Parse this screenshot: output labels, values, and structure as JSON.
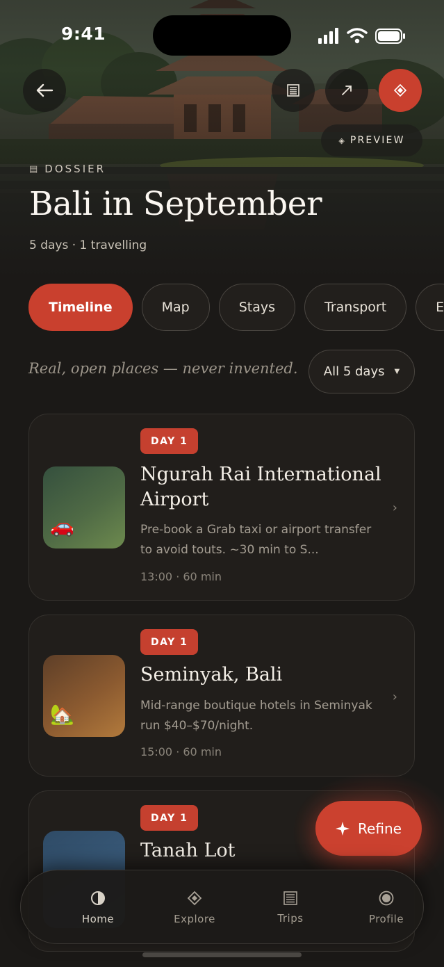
{
  "status_bar": {
    "time": "9:41"
  },
  "header": {
    "section_label": "DOSSIER",
    "title": "Bali in September",
    "meta": "5 days · 1 travelling",
    "preview_label": "PREVIEW",
    "icons": {
      "back": "arrow-left-icon",
      "document": "document-icon",
      "share": "arrow-up-right-icon",
      "diamond": "diamond-icon"
    }
  },
  "tabs": [
    {
      "label": "Timeline",
      "active": true
    },
    {
      "label": "Map",
      "active": false
    },
    {
      "label": "Stays",
      "active": false
    },
    {
      "label": "Transport",
      "active": false
    },
    {
      "label": "E",
      "active": false
    }
  ],
  "timeline": {
    "tagline": "Real, open places — never invented.",
    "day_filter": "All 5 days"
  },
  "cards": [
    {
      "day": "DAY 1",
      "name": "Ngurah Rai International Airport",
      "description": "Pre-book a Grab taxi or airport transfer to avoid touts. ~30 min to S...",
      "time": "13:00 · 60 min",
      "emoji": "🚗",
      "icon": "car-icon"
    },
    {
      "day": "DAY 1",
      "name": "Seminyak, Bali",
      "description": "Mid-range boutique hotels in Seminyak run $40–$70/night.",
      "time": "15:00 · 60 min",
      "emoji": "🏡",
      "icon": "house-icon"
    },
    {
      "day": "DAY 1",
      "name": "Tanah Lot"
    }
  ],
  "fab": {
    "label": "Refine"
  },
  "nav": [
    {
      "label": "Home",
      "icon": "half-circle-icon"
    },
    {
      "label": "Explore",
      "icon": "diamond-icon"
    },
    {
      "label": "Trips",
      "icon": "document-icon"
    },
    {
      "label": "Profile",
      "icon": "profile-icon"
    }
  ],
  "colors": {
    "accent": "#c9402e",
    "background": "#1b1917",
    "card": "#211e1b"
  }
}
